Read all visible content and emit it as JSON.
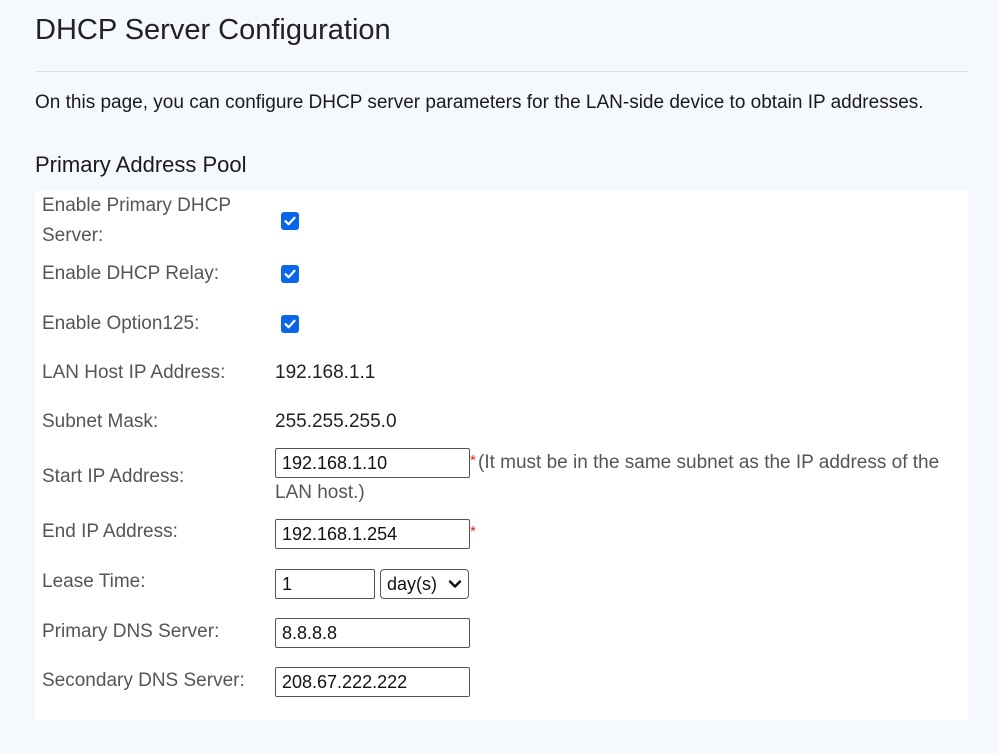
{
  "page": {
    "title": "DHCP Server Configuration",
    "description": "On this page, you can configure DHCP server parameters for the LAN-side device to obtain IP addresses."
  },
  "section": {
    "title": "Primary Address Pool"
  },
  "fields": {
    "enable_primary_dhcp": {
      "label_line1": "Enable Primary DHCP",
      "label_line2": "Server:",
      "checked": true
    },
    "enable_dhcp_relay": {
      "label": "Enable DHCP Relay:",
      "checked": true
    },
    "enable_option125": {
      "label": "Enable Option125:",
      "checked": true
    },
    "lan_host_ip": {
      "label": "LAN Host IP Address:",
      "value": "192.168.1.1"
    },
    "subnet_mask": {
      "label": "Subnet Mask:",
      "value": "255.255.255.0"
    },
    "start_ip": {
      "label": "Start IP Address:",
      "value": "192.168.1.10",
      "required_mark": "*",
      "hint_line1": "(It must be in the same subnet as the IP address of the",
      "hint_line2": "LAN host.)"
    },
    "end_ip": {
      "label": "End IP Address:",
      "value": "192.168.1.254",
      "required_mark": "*"
    },
    "lease_time": {
      "label": "Lease Time:",
      "value": "1",
      "unit_selected": "day(s)"
    },
    "primary_dns": {
      "label": "Primary DNS Server:",
      "value": "8.8.8.8"
    },
    "secondary_dns": {
      "label": "Secondary DNS Server:",
      "value": "208.67.222.222"
    }
  },
  "colors": {
    "page_bg": "#f5f8fc",
    "panel_bg": "#ffffff",
    "checkbox_blue": "#0a66e8",
    "required_red": "#e02424"
  },
  "icons": {
    "checkbox": "check-icon",
    "select": "chevron-down-icon"
  }
}
